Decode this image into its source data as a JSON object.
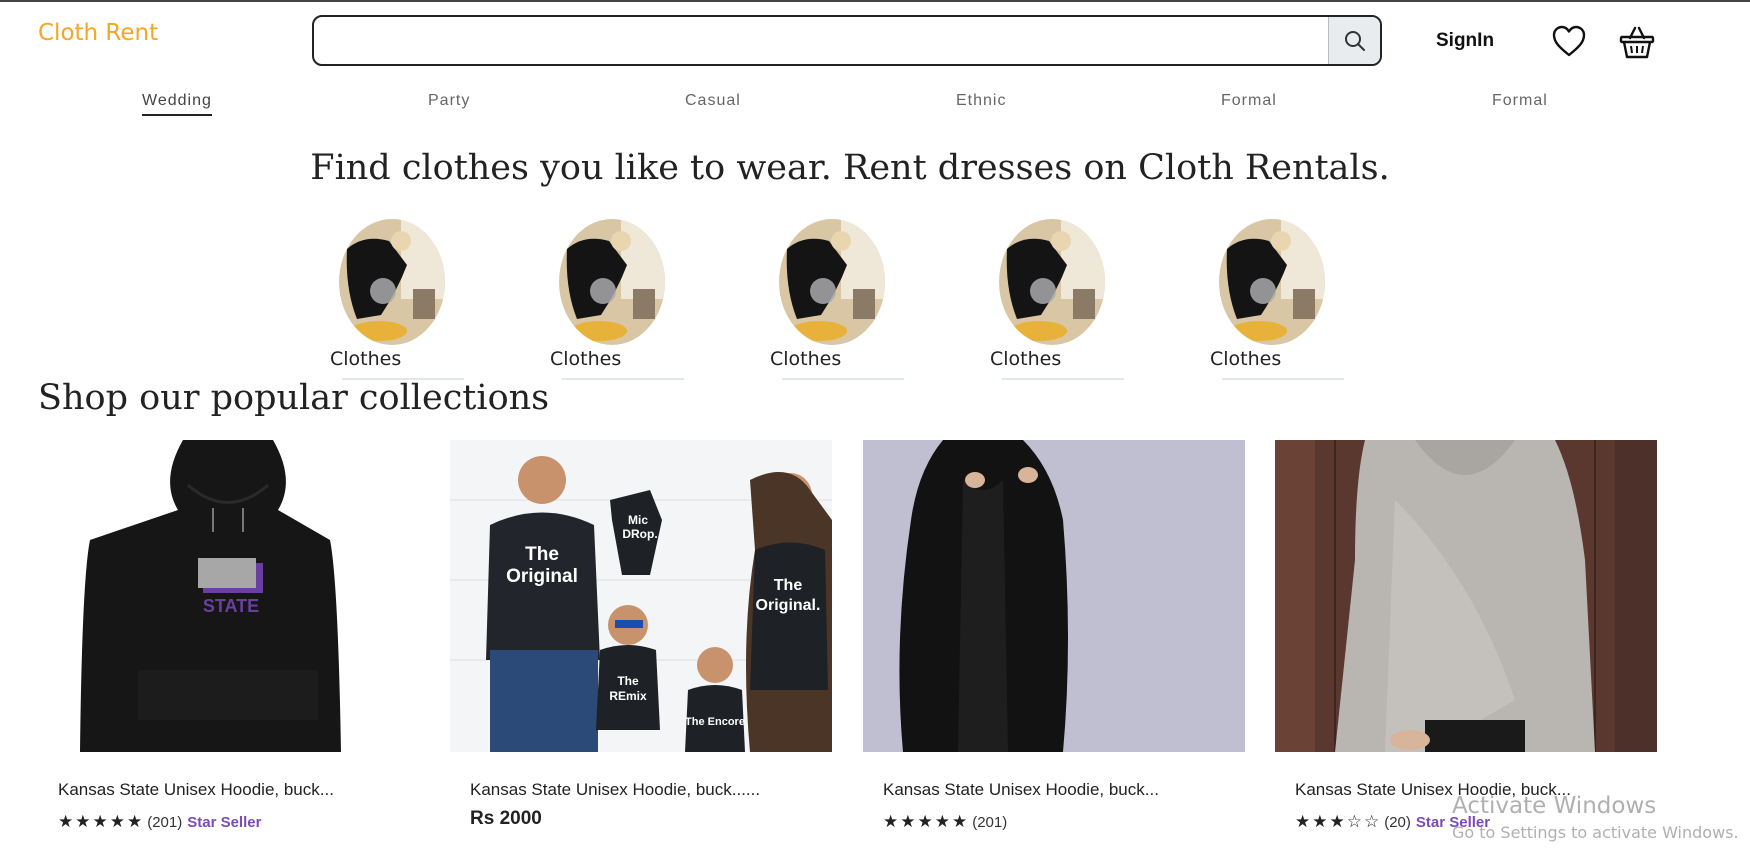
{
  "header": {
    "brand": "Cloth Rent",
    "search": {
      "value": "",
      "placeholder": ""
    },
    "signin_label": "SignIn"
  },
  "categories": [
    {
      "label": "Wedding",
      "active": true
    },
    {
      "label": "Party",
      "active": false
    },
    {
      "label": "Casual",
      "active": false
    },
    {
      "label": "Ethnic",
      "active": false
    },
    {
      "label": "Formal",
      "active": false
    },
    {
      "label": "Formal",
      "active": false
    }
  ],
  "hero": {
    "title": "Find clothes you like to wear. Rent dresses on Cloth Rentals."
  },
  "circle_items": [
    {
      "label": "Clothes"
    },
    {
      "label": "Clothes"
    },
    {
      "label": "Clothes"
    },
    {
      "label": "Clothes"
    },
    {
      "label": "Clothes"
    }
  ],
  "collections": {
    "title": "Shop our popular collections",
    "products": [
      {
        "name": "Kansas State Unisex Hoodie, buck...",
        "stars": "★★★★★",
        "reviews": "(201)",
        "badge": "Star Seller",
        "image": "black hoodie with STATE print"
      },
      {
        "name": "Kansas State Unisex Hoodie, buck......",
        "price": "Rs 2000",
        "image": "family in matching t-shirts"
      },
      {
        "name": "Kansas State Unisex Hoodie, buck...",
        "stars": "★★★★★",
        "reviews": "(201)",
        "image": "woman in black coat"
      },
      {
        "name": "Kansas State Unisex Hoodie, buck...",
        "stars": "★★★☆☆",
        "reviews": "(20)",
        "badge": "Star Seller",
        "image": "woman in grey wrap cardigan"
      }
    ]
  },
  "watermark": {
    "title": "Activate Windows",
    "subtitle": "Go to Settings to activate Windows."
  },
  "colors": {
    "brand": "#f5a623",
    "badge": "#7d4bb8",
    "search_button_bg": "#e9ecef"
  },
  "icons": {
    "search": "search-icon",
    "wishlist": "heart-icon",
    "cart": "basket-icon"
  }
}
